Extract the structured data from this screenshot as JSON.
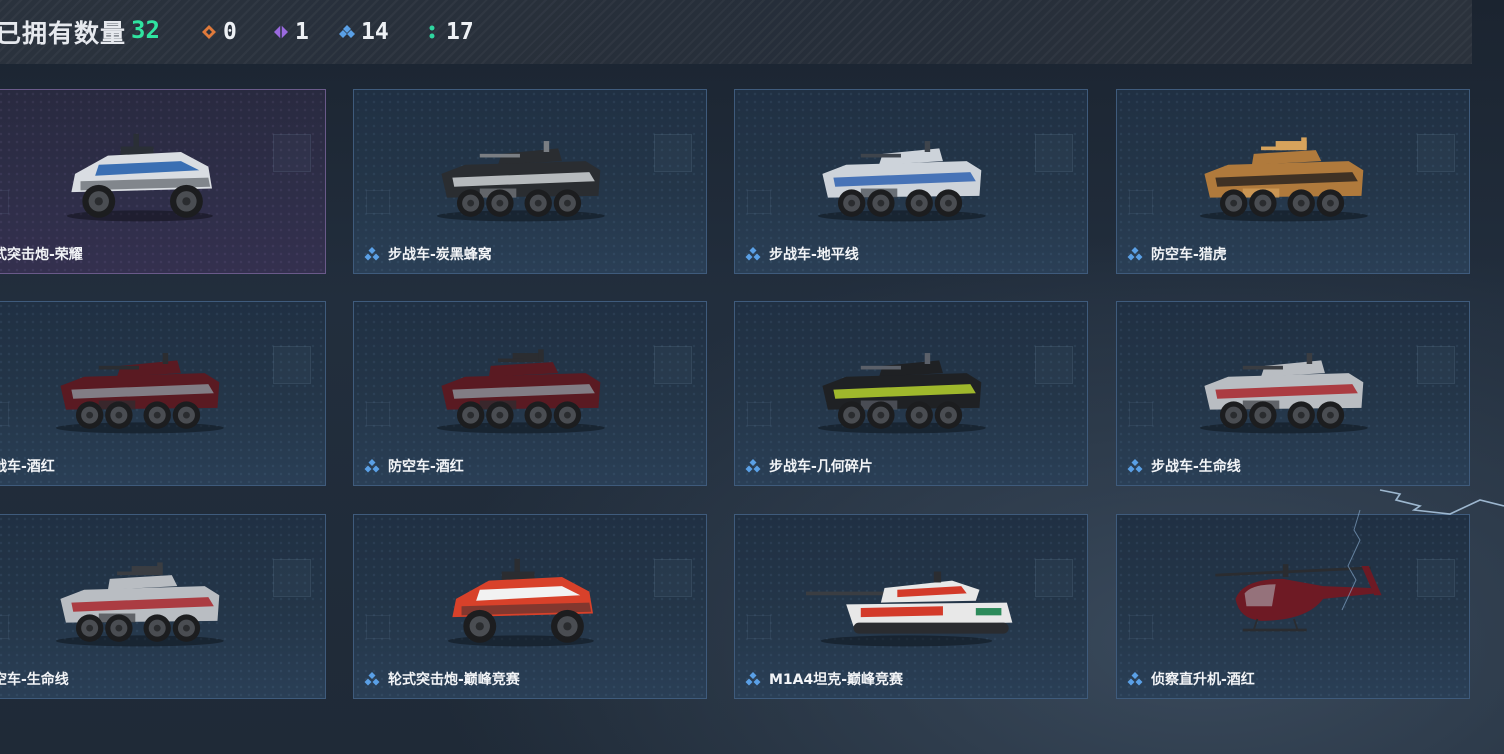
{
  "header": {
    "owned_label": "已拥有数量",
    "owned_total": "32",
    "rarity_counts": [
      {
        "icon": "orange-diamond-icon",
        "color": "#e07a3b",
        "count": "0"
      },
      {
        "icon": "purple-diamond-icon",
        "color": "#9b6ae0",
        "count": "1"
      },
      {
        "icon": "blue-diamond-icon",
        "color": "#5aa0e6",
        "count": "14"
      },
      {
        "icon": "green-dots-icon",
        "color": "#2fd6a0",
        "count": "17"
      }
    ]
  },
  "colors": {
    "accent_green": "#2fe3a0",
    "card_border": "#3f5b7c",
    "legend_border": "#6a5a8a",
    "rarity_blue": "#5aa0e6"
  },
  "vehicles": [
    {
      "label": "轮式突击炮-荣耀",
      "rarity_icon": "none",
      "kind": "buggy",
      "scheme": [
        "#d9dde2",
        "#3a6fb3",
        "#2a2f36"
      ]
    },
    {
      "label": "步战车-炭黑蜂窝",
      "rarity_icon": "blue-diamond-icon",
      "kind": "ifv",
      "scheme": [
        "#2a2d31",
        "#cfd3d6",
        "#7a7e83"
      ]
    },
    {
      "label": "步战车-地平线",
      "rarity_icon": "blue-diamond-icon",
      "kind": "ifv",
      "scheme": [
        "#cdd3da",
        "#2f62b0",
        "#3e444c"
      ]
    },
    {
      "label": "防空车-猎虎",
      "rarity_icon": "blue-diamond-icon",
      "kind": "aa",
      "scheme": [
        "#b07a3c",
        "#2b2520",
        "#d7a35c"
      ]
    },
    {
      "label": "步战车-酒红",
      "rarity_icon": "none",
      "kind": "ifv",
      "scheme": [
        "#5a1a22",
        "#8a8f96",
        "#2b2d31"
      ]
    },
    {
      "label": "防空车-酒红",
      "rarity_icon": "blue-diamond-icon",
      "kind": "aa",
      "scheme": [
        "#5a1a22",
        "#8a8f96",
        "#2b2d31"
      ]
    },
    {
      "label": "步战车-几何碎片",
      "rarity_icon": "blue-diamond-icon",
      "kind": "ifv",
      "scheme": [
        "#1f2124",
        "#b6d22e",
        "#5b6069"
      ]
    },
    {
      "label": "步战车-生命线",
      "rarity_icon": "blue-diamond-icon",
      "kind": "ifv",
      "scheme": [
        "#b9bdc2",
        "#a8262c",
        "#3a3d42"
      ]
    },
    {
      "label": "防空车-生命线",
      "rarity_icon": "none",
      "kind": "aa",
      "scheme": [
        "#b9bdc2",
        "#a8262c",
        "#3a3d42"
      ]
    },
    {
      "label": "轮式突击炮-巅峰竞赛",
      "rarity_icon": "blue-diamond-icon",
      "kind": "buggy",
      "scheme": [
        "#d8412a",
        "#f2f2f2",
        "#2b2d31"
      ]
    },
    {
      "label": "M1A4坦克-巅峰竞赛",
      "rarity_icon": "blue-diamond-icon",
      "kind": "tank",
      "scheme": [
        "#e8e8e8",
        "#d33a2a",
        "#2c8a5a"
      ]
    },
    {
      "label": "侦察直升机-酒红",
      "rarity_icon": "blue-diamond-icon",
      "kind": "heli",
      "scheme": [
        "#6e1a24",
        "#2a2c30",
        "#b7bcc2"
      ]
    }
  ]
}
